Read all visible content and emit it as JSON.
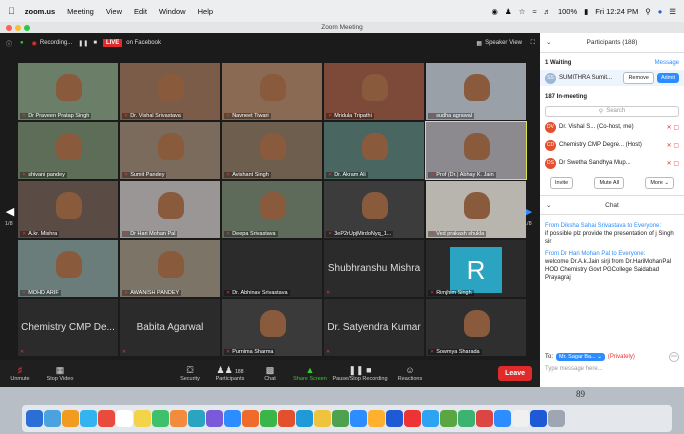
{
  "menubar": {
    "app": "zoom.us",
    "items": [
      "Meeting",
      "View",
      "Edit",
      "Window",
      "Help"
    ],
    "battery": "100%",
    "clock": "Fri 12:24 PM"
  },
  "window": {
    "title": "Zoom Meeting"
  },
  "toolbar": {
    "recording": "Recording...",
    "live": "LIVE",
    "facebook": "on Facebook",
    "speaker_view": "Speaker View"
  },
  "tiles": [
    {
      "name": "Dr Praveen Pratap Singh",
      "type": "video",
      "color": "#6b7f68"
    },
    {
      "name": "Dr. Vishal Srivastava",
      "type": "video",
      "color": "#7b5c48"
    },
    {
      "name": "Navneet Tiwari",
      "type": "video",
      "color": "#8a6a52"
    },
    {
      "name": "Mridula Tripathi",
      "type": "video",
      "color": "#7d4a3a"
    },
    {
      "name": "sudha agrawal",
      "type": "video",
      "color": "#9aa0a8"
    },
    {
      "name": "shivani pandey",
      "type": "video",
      "color": "#5d6d57"
    },
    {
      "name": "Sumit Pandey",
      "type": "video",
      "color": "#7a6b5d"
    },
    {
      "name": "Avishant Singh",
      "type": "video",
      "color": "#6d5e4e"
    },
    {
      "name": "Dr. Akram Ali",
      "type": "video",
      "color": "#4a6660"
    },
    {
      "name": "Prof (Dr.) Abhay K. Jain",
      "type": "video",
      "color": "#8c8a8e"
    },
    {
      "name": "A.kr. Mishra",
      "type": "video",
      "color": "#5b4b45"
    },
    {
      "name": "Dr Hari Mohan Pal",
      "type": "video",
      "color": "#9a9696"
    },
    {
      "name": "Deepa Srivastava",
      "type": "video",
      "color": "#5f6b5a"
    },
    {
      "name": "3eP2rUpjMirdoNyq_1...",
      "type": "video",
      "color": "#3c3c3c"
    },
    {
      "name": "Ved prakash shukla",
      "type": "video",
      "color": "#b8b4ae"
    },
    {
      "name": "MOHD ARIF",
      "type": "video",
      "color": "#6b7d7a"
    },
    {
      "name": "AWANISH PANDEY",
      "type": "video",
      "color": "#7d7468"
    },
    {
      "name": "Dr. Abhinav Srivastava",
      "type": "blank",
      "color": "#2b2b2b"
    },
    {
      "name": "Shubhranshu Mishra",
      "type": "text",
      "color": "#2b2b2b"
    },
    {
      "name": "Rimjhim Singh",
      "type": "letter",
      "letter": "R",
      "color": "#2b2b2b"
    },
    {
      "name": "Chemistry CMP De...",
      "type": "text",
      "color": "#2b2b2b"
    },
    {
      "name": "Babita Agarwal",
      "type": "text",
      "color": "#2b2b2b"
    },
    {
      "name": "Purnima Sharma",
      "type": "video",
      "color": "#3a3a3a"
    },
    {
      "name": "Dr. Satyendra Kumar",
      "type": "text",
      "color": "#2b2b2b"
    },
    {
      "name": "Sowmya Sharada",
      "type": "video",
      "color": "#2f2f2f"
    }
  ],
  "pager": {
    "left": "1/8",
    "right": "1/8"
  },
  "bottom": {
    "items": [
      "Unmute",
      "Stop Video",
      "Security",
      "Participants",
      "Chat",
      "Share Screen",
      "Pause/Stop Recording",
      "Reactions"
    ],
    "participants_count": "188",
    "leave": "Leave"
  },
  "panel": {
    "title": "Participants (188)",
    "waiting": "1 Waiting",
    "message": "Message",
    "waiting_user": "SUMITHRA Sumit...",
    "remove": "Remove",
    "admit": "Admit",
    "in_meeting": "187 In-meeting",
    "search_placeholder": "Search",
    "participants": [
      {
        "initials": "DV",
        "name": "Dr. Vishal S... (Co-host, me)",
        "color": "#e2502e"
      },
      {
        "initials": "CD",
        "name": "Chemistry CMP Degre... (Host)",
        "color": "#e2502e"
      },
      {
        "initials": "DS",
        "name": "Dr Swetha Sandhya Mup...",
        "color": "#e2502e"
      }
    ],
    "invite": "Invite",
    "mute_all": "Mute All",
    "more": "More"
  },
  "chat": {
    "title": "Chat",
    "messages": [
      {
        "from": "From Diksha Sahai Srivastava to Everyone:",
        "text": "if possible plz provide the presentation of j Singh sir"
      },
      {
        "from": "From Dr Hari Mohan Pal to Everyone:",
        "text": "welcome Dr.A.k.Jain sirji from Dr.HariMohanPal HOD Chemistry Govt PGCollege Saidabad Prayagraj"
      }
    ],
    "to_label": "To:",
    "to_value": "Mr. Sagar Ba...",
    "privately": "(Privately)",
    "placeholder": "Type message here..."
  },
  "dock": {
    "number": "89"
  }
}
